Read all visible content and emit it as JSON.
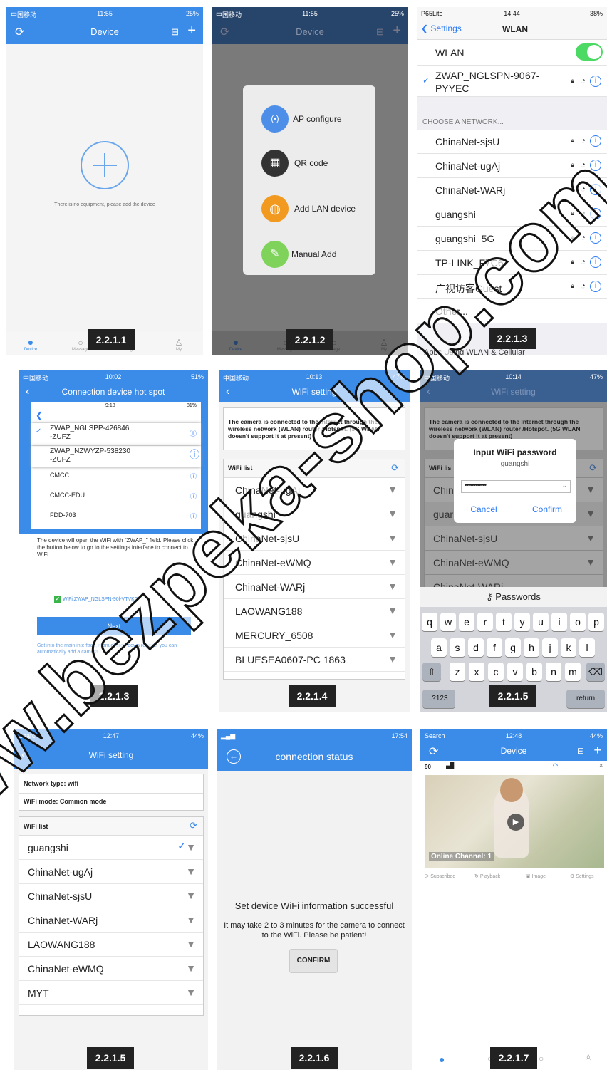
{
  "p1": {
    "status_left": "中国移动",
    "status_time": "11:55",
    "status_right": "25%",
    "nav_title": "Device",
    "empty_text": "There is no equipment, please add the device",
    "tabs": [
      "Device",
      "Message",
      "Image",
      "My"
    ],
    "fig": "2.2.1.1"
  },
  "p2": {
    "status_left": "中国移动",
    "status_time": "11:55",
    "status_right": "25%",
    "nav_title": "Device",
    "menu": [
      "AP configure",
      "QR code",
      "Add LAN device",
      "Manual Add"
    ],
    "tabs": [
      "Device",
      "Message",
      "Image",
      "My"
    ],
    "fig": "2.2.1.2"
  },
  "p3": {
    "status_left": "P65Lite",
    "status_time": "14:44",
    "status_right": "38%",
    "back": "Settings",
    "title": "WLAN",
    "wlan_label": "WLAN",
    "connected": "ZWAP_NGLSPN-90",
    "connected_mid": "67-",
    "connected_sub": "PYYEC",
    "choose_header": "CHOOSE A NETWORK...",
    "networks": [
      "ChinaNet-sjsU",
      "ChinaNet-ugAj",
      "ChinaNet-WARj",
      "guangshi",
      "guangshi_5G",
      "TP-LINK_F7C6",
      "广视访客Guest",
      "Other..."
    ],
    "footer_partial": "Apps Using WLAN & Cellular",
    "fig": "2.2.1.3"
  },
  "p4": {
    "status_left": "中国移动",
    "status_time": "10:02",
    "status_right": "51%",
    "nav_title": "Connection device hot spot",
    "inner_time": "9:18",
    "inner_battery": "81%",
    "inner_networks": [
      "ZWAP_NGLSPP-426846",
      "-ZUFZ",
      "ZWAP_NZWYZP-538230",
      "-ZUFZ",
      "CMCC",
      "CMCC-EDU",
      "FDD-703"
    ],
    "instructions": "The device will open the WiFi with \"ZWAP_\" field. Please click the button below to go to the settings interface to connect to WiFi",
    "wifi_line": "WiFi:ZWAP_NGLSPN-90l",
    "wifi_line_end": "-VTVKG",
    "next": "Next",
    "hint": "Get into the main interface, manual drop-down refresh, you can automatically add a camera",
    "fig": "2.2.1.3"
  },
  "p5": {
    "status_left": "中国移动",
    "status_time": "10:13",
    "status_right": "47%",
    "nav_title": "WiFi setting",
    "notice": "The camera is connected to the Internet through the wireless network (WLAN) router /Hotspot. (5G WLAN doesn't support it at present)",
    "list_header": "WiFi list",
    "networks": [
      "ChinaNet-ugAj",
      "guangshi",
      "ChinaNet-sjsU",
      "ChinaNet-eWMQ",
      "ChinaNet-WARj",
      "LAOWANG188",
      "MERCURY_6508",
      "BLUESEA0607-PC 1863"
    ],
    "fig": "2.2.1.4"
  },
  "p6": {
    "status_left": "中国移动",
    "status_time": "10:14",
    "status_right": "47%",
    "nav_title": "WiFi setting",
    "notice": "The camera is connected to the Internet through the wireless network (WLAN) router /Hotspot. (5G WLAN doesn't support it at present)",
    "list_header": "WiFi lis",
    "networks": [
      "Chin",
      "guar",
      "ChinaNet-sjsU",
      "ChinaNet-eWMQ",
      "ChinaNet-WARj"
    ],
    "dialog_title": "Input WiFi password",
    "dialog_ssid": "guangshi",
    "dialog_password": "••••••••••••",
    "cancel": "Cancel",
    "confirm": "Confirm",
    "kb_header": "Passwords",
    "row1": [
      "q",
      "w",
      "e",
      "r",
      "t",
      "y",
      "u",
      "i",
      "o",
      "p"
    ],
    "row2": [
      "a",
      "s",
      "d",
      "f",
      "g",
      "h",
      "j",
      "k",
      "l"
    ],
    "row3": [
      "z",
      "x",
      "c",
      "v",
      "b",
      "n",
      "m"
    ],
    "num_key": ".?123",
    "return_key": "return",
    "fig": "2.2.1.5"
  },
  "p7": {
    "status_left": "Search",
    "status_time": "12:47",
    "status_right": "44%",
    "nav_title": "WiFi setting",
    "network_type": "Network type:  wifi",
    "wifi_mode": "WiFi mode:  Common mode",
    "list_header": "WiFi list",
    "networks": [
      "guangshi",
      "ChinaNet-ugAj",
      "ChinaNet-sjsU",
      "ChinaNet-WARj",
      "LAOWANG188",
      "ChinaNet-eWMQ",
      "MYT"
    ],
    "fig": "2.2.1.5"
  },
  "p8": {
    "status_right": "17:54",
    "title": "connection status",
    "success": "Set device WiFi information successful",
    "wait": "It may take 2 to 3 minutes for the camera to connect to the WiFi. Please be patient!",
    "confirm": "CONFIRM",
    "fig": "2.2.1.6"
  },
  "p9": {
    "status_left": "Search",
    "status_time": "12:48",
    "status_right": "44%",
    "nav_title": "Device",
    "device_name": "90",
    "channel": "Online Channel: 1",
    "actions": [
      "Subscribed",
      "Playback",
      "Image",
      "Settings"
    ],
    "fig": "2.2.1.7"
  },
  "watermark": "www.bezpeka-shop.com",
  "colors": {
    "accent": "#3b8be8",
    "ios_blue": "#2d7bf6",
    "toggle_green": "#4cd964",
    "dark_label": "#222222"
  }
}
